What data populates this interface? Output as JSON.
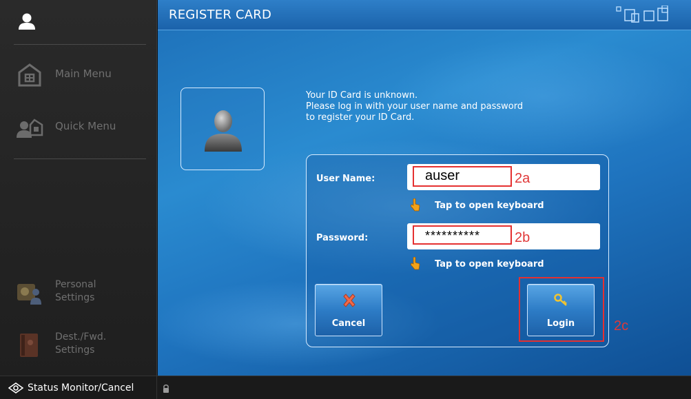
{
  "sidebar": {
    "items": [
      {
        "label": "Main Menu",
        "icon": "home-icon"
      },
      {
        "label": "Quick Menu",
        "icon": "quick-menu-icon"
      },
      {
        "label": "Personal Settings",
        "icon": "personal-settings-icon"
      },
      {
        "label": "Dest./Fwd. Settings",
        "icon": "address-book-icon"
      }
    ]
  },
  "header": {
    "title": "REGISTER CARD"
  },
  "message": {
    "line1": "Your ID Card is unknown.",
    "line2": "Please log in with your user name and password",
    "line3": "to register your ID Card."
  },
  "form": {
    "username_label": "User Name:",
    "username_value": "auser",
    "password_label": "Password:",
    "password_value": "**********",
    "keyboard_hint": "Tap to open keyboard"
  },
  "annotations": {
    "username_tag": "2a",
    "password_tag": "2b",
    "login_tag": "2c"
  },
  "buttons": {
    "cancel": "Cancel",
    "login": "Login"
  },
  "status_bar": {
    "label": "Status Monitor/Cancel"
  },
  "colors": {
    "accent_blue": "#1f74bf",
    "annotation_red": "#e53030"
  }
}
